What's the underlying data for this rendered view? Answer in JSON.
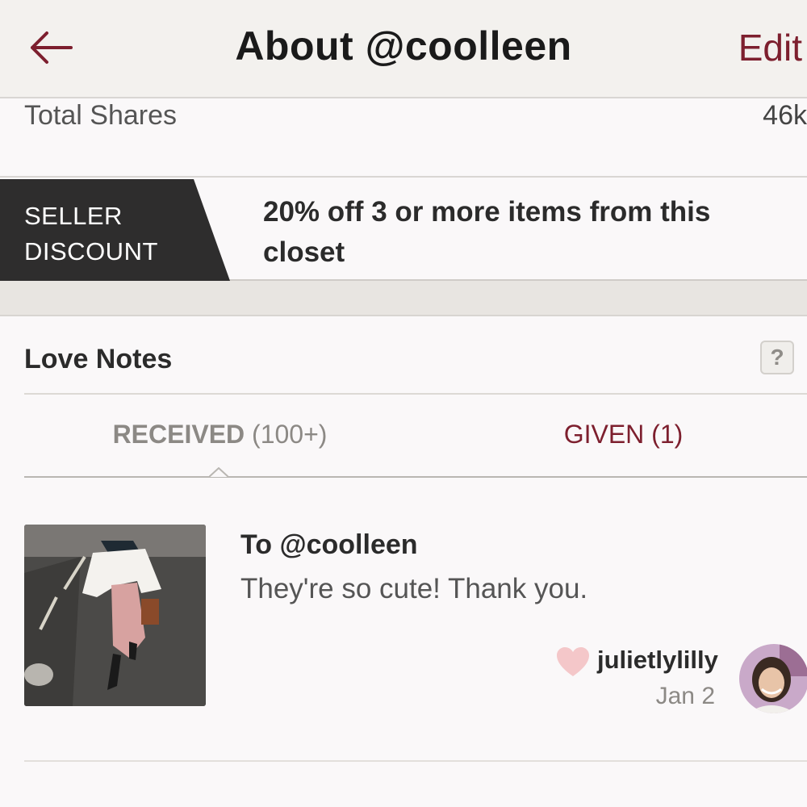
{
  "header": {
    "title": "About @coolleen",
    "edit_label": "Edit",
    "back_icon": "arrow-left-icon",
    "accent_color": "#7d1f2e"
  },
  "stats": {
    "total_shares_label": "Total Shares",
    "total_shares_value": "46k"
  },
  "seller_discount": {
    "tag_line1": "SELLER",
    "tag_line2": "DISCOUNT",
    "text": "20% off 3 or more items from this closet"
  },
  "love_notes": {
    "title": "Love Notes",
    "help_label": "?",
    "tabs": {
      "received_label": "RECEIVED",
      "received_count": "(100+)",
      "given_label": "GIVEN (1)",
      "active": "received"
    },
    "notes": [
      {
        "to": "To @coolleen",
        "message": "They're so cute! Thank you.",
        "user": "julietlylilly",
        "date": "Jan 2",
        "icon": "heart-icon"
      }
    ]
  }
}
